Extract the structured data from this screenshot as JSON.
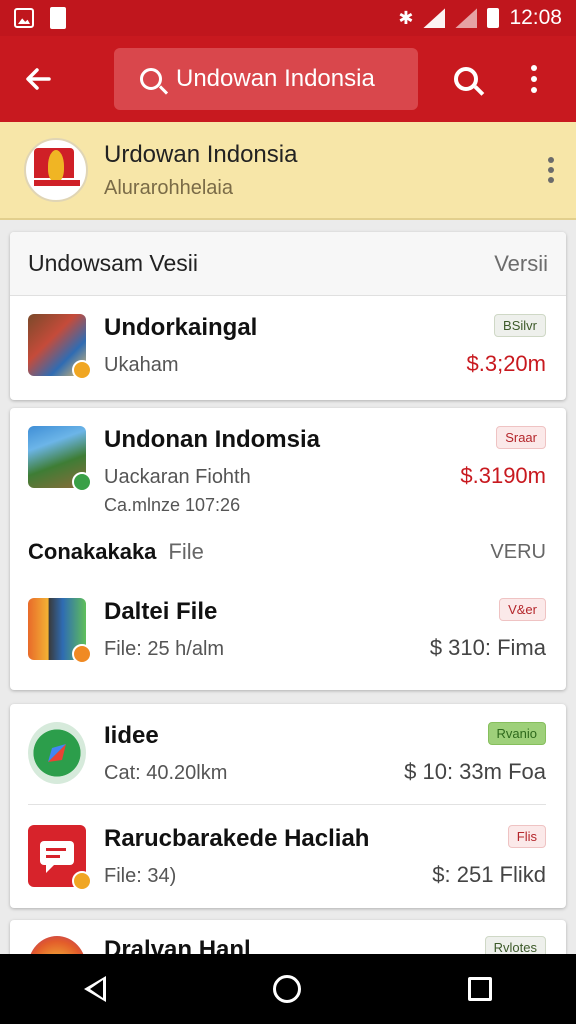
{
  "status_bar": {
    "time": "12:08"
  },
  "app_bar": {
    "search_text": "Undowan Indonsia"
  },
  "app_header": {
    "title": "Urdowan Indonsia",
    "subtitle": "Alurarohhelaia"
  },
  "card1": {
    "section_title": "Undowsam Vesii",
    "section_right": "Versii",
    "rows": [
      {
        "name": "Undorkaingal",
        "sub": "Ukaham",
        "tag": "BSilvr",
        "price": "$.3;20m"
      }
    ]
  },
  "card2": {
    "rows": [
      {
        "name": "Undonan Indomsia",
        "sub": "Uackaran Fiohth",
        "sub2": "Ca.mlnze 107:26",
        "tag": "Sraar",
        "price": "$.3190m"
      }
    ],
    "section_title": "Conakakaka",
    "section_title_suffix": "File",
    "section_right": "VERU",
    "rows2": [
      {
        "name": "Daltei File",
        "sub": "File: 25 h/alm",
        "tag": "V&er",
        "price": "$ 310: Fima"
      }
    ]
  },
  "card3": {
    "rows": [
      {
        "name": "Iidee",
        "sub": "Cat: 40.20lkm",
        "tag": "Rvanio",
        "price": "$ 10: 33m Foa"
      },
      {
        "name": "Rarucbarakede Hacliah",
        "sub": "File: 34)",
        "tag": "Flis",
        "price": "$: 251 Flikd"
      }
    ]
  },
  "card4": {
    "name": "Dralvan Hanl",
    "tag": "Rvlotes"
  },
  "colors": {
    "primary": "#c8191f",
    "header_bg": "#f7e6a8",
    "price_red": "#c8191f",
    "price_gray": "#444444"
  }
}
